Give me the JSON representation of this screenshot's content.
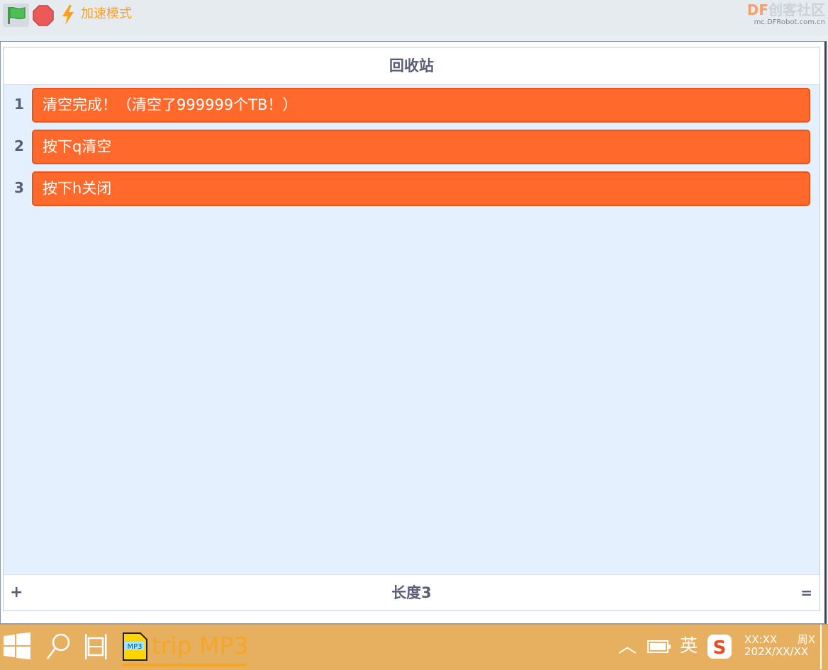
{
  "toolbar": {
    "turbo_label": "加速模式",
    "icons": [
      "green-flag-icon",
      "stop-icon",
      "lightning-icon"
    ]
  },
  "watermark": {
    "brand_prefix": "DF",
    "brand_suffix": "创客社区",
    "url": "mc.DFRobot.com.cn",
    "close_glyph": "✕"
  },
  "list_monitor": {
    "title": "回收站",
    "items": [
      {
        "index": "1",
        "value": "清空完成！（清空了999999个TB！）"
      },
      {
        "index": "2",
        "value": "按下q清空"
      },
      {
        "index": "3",
        "value": "按下h关闭"
      }
    ],
    "add_glyph": "+",
    "length_label": "长度3",
    "resize_glyph": "="
  },
  "taskbar": {
    "app_label": "trip  MP3",
    "mp3_icon_text": "MP3",
    "chevron": "^",
    "ime_label": "英",
    "clock_time": "XX:XX",
    "clock_weekday": "周X",
    "clock_date": "202X/XX/XX"
  },
  "colors": {
    "item_bg": "#ff6a2c",
    "list_bg": "#e5f0ff",
    "taskbar_bg": "#e6b060",
    "turbo_text": "#ff9f1c"
  }
}
